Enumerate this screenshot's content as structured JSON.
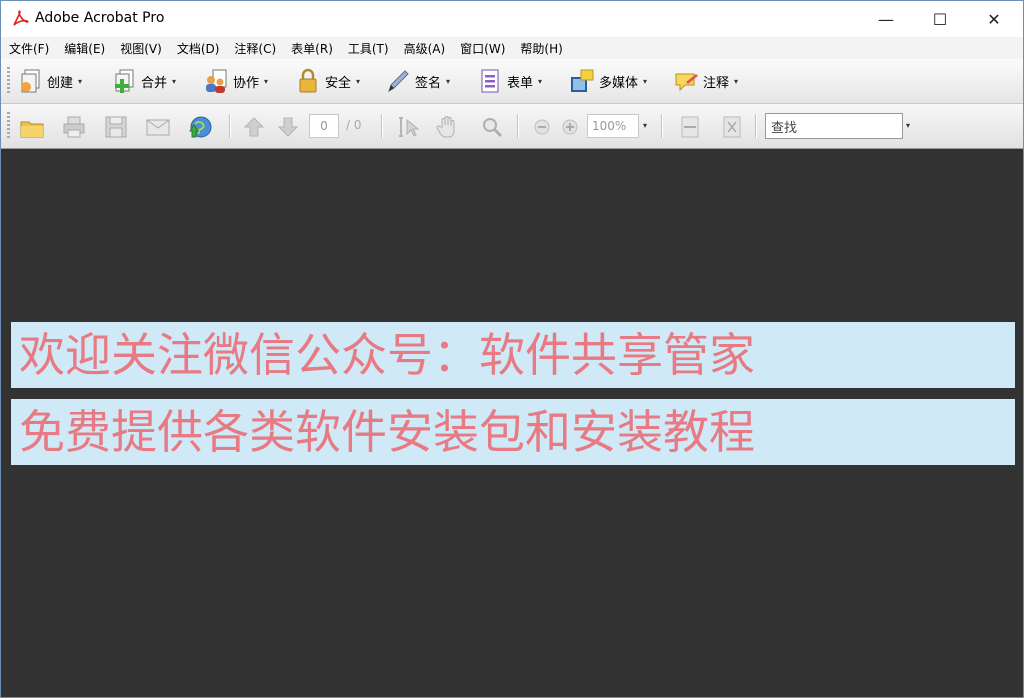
{
  "window": {
    "title": "Adobe Acrobat Pro",
    "controls": {
      "minimize": "—",
      "maximize": "☐",
      "close": "✕"
    }
  },
  "menu": [
    "文件(F)",
    "编辑(E)",
    "视图(V)",
    "文档(D)",
    "注释(C)",
    "表单(R)",
    "工具(T)",
    "高级(A)",
    "窗口(W)",
    "帮助(H)"
  ],
  "toolbar": {
    "create": "创建",
    "combine": "合并",
    "collaborate": "协作",
    "secure": "安全",
    "sign": "签名",
    "forms": "表单",
    "multimedia": "多媒体",
    "comment": "注释",
    "dropdown_glyph": "▾"
  },
  "nav": {
    "page_current": "0",
    "page_total": "/ 0",
    "zoom": "100%",
    "search_value": "查找"
  },
  "document": {
    "line1": "欢迎关注微信公众号：软件共享管家",
    "line2": "免费提供各类软件安装包和安装教程"
  },
  "colors": {
    "doc_background": "#333233",
    "banner_background": "#cfe9f7",
    "banner_text": "#e77a83"
  }
}
